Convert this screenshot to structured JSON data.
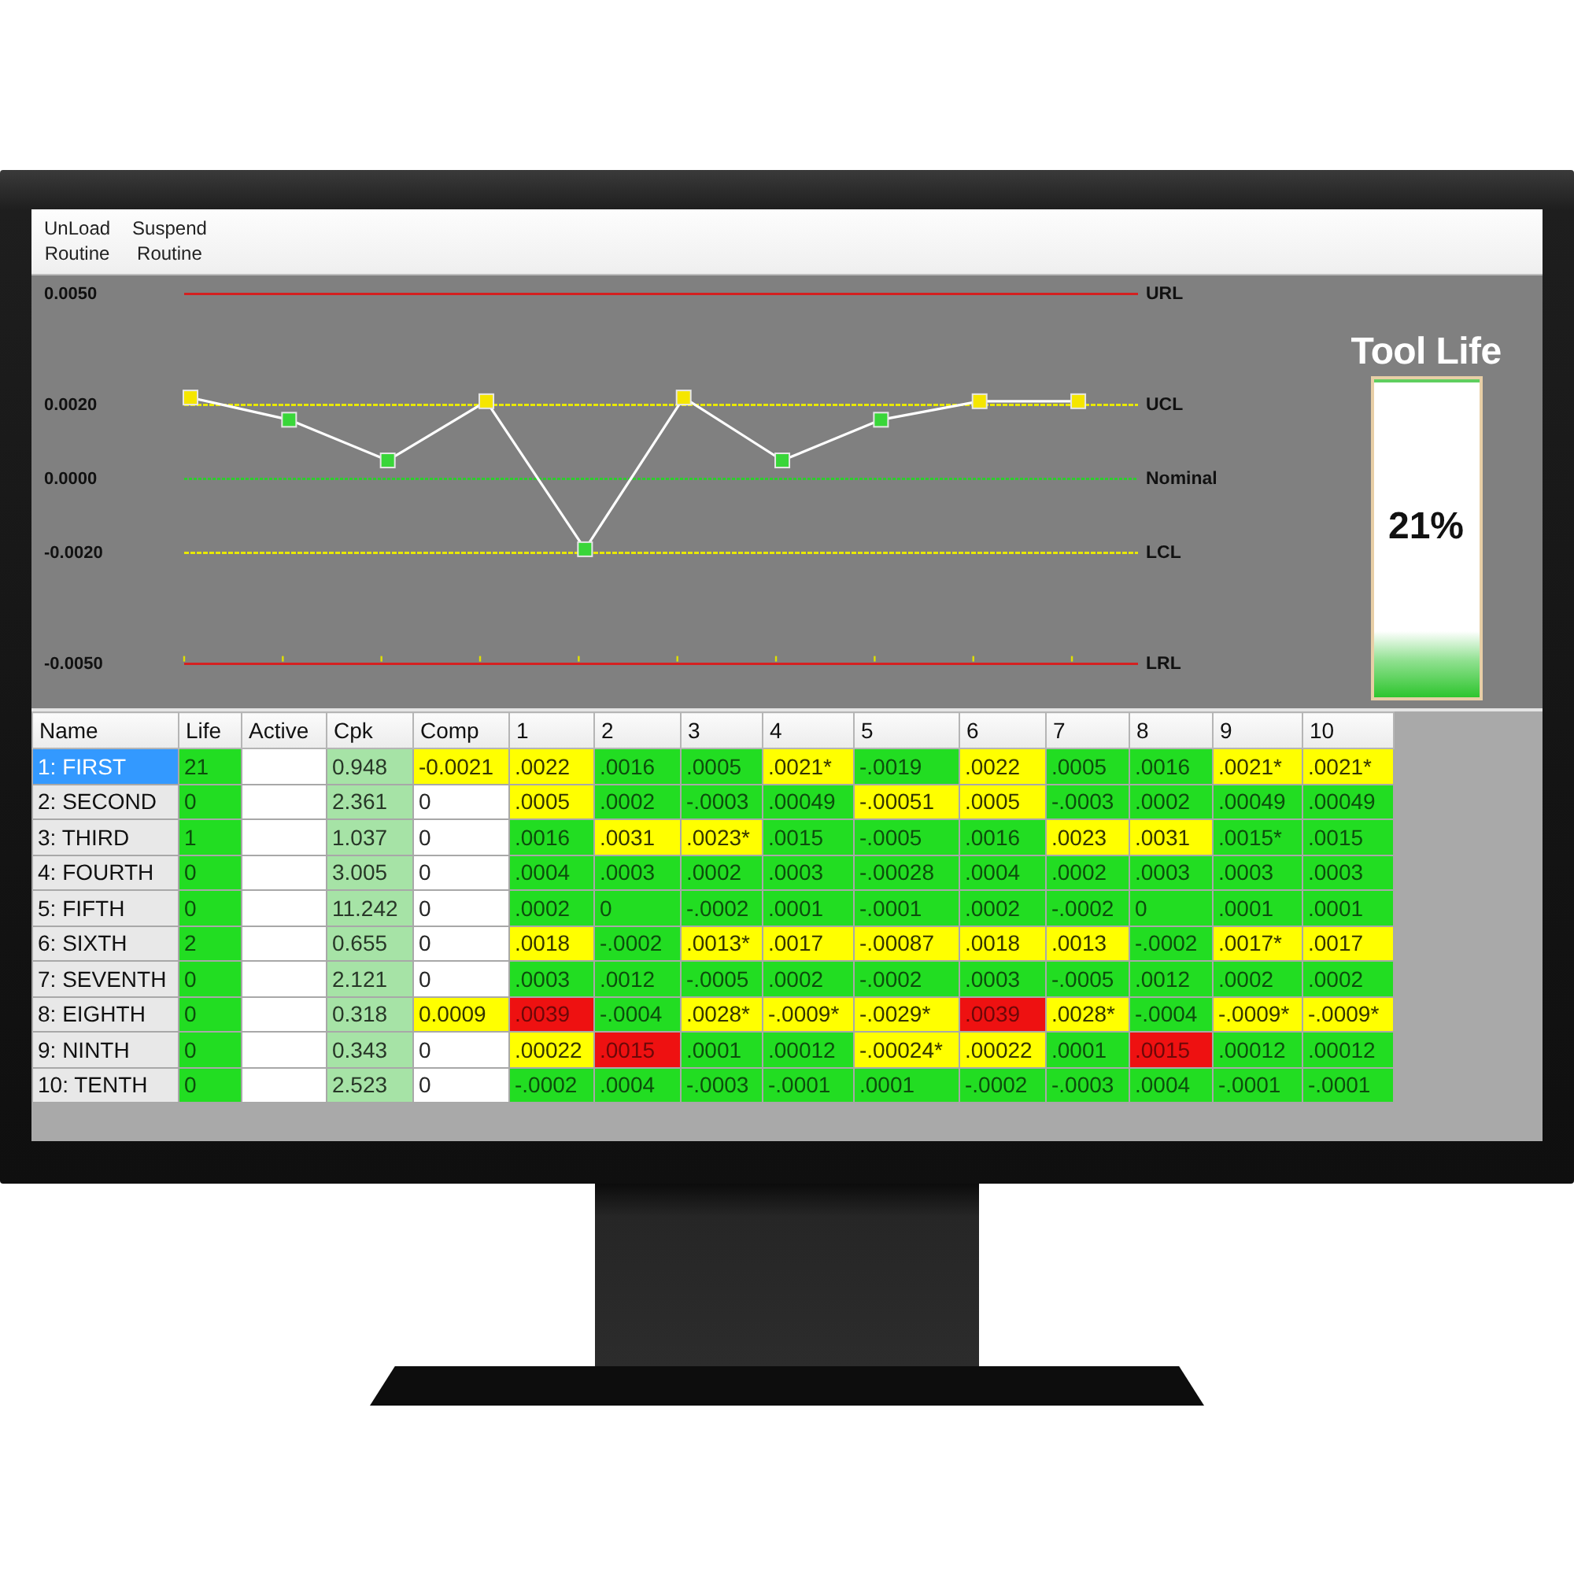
{
  "toolbar": {
    "buttons": [
      "UnLoad Routine",
      "Suspend Routine"
    ]
  },
  "chart": {
    "chart_data": {
      "type": "line",
      "ylim": [
        -0.005,
        0.005
      ],
      "yticks": [
        {
          "value": 0.005,
          "label": "0.0050"
        },
        {
          "value": 0.002,
          "label": "0.0020"
        },
        {
          "value": 0,
          "label": "0.0000"
        },
        {
          "value": -0.002,
          "label": "-0.0020"
        },
        {
          "value": -0.005,
          "label": "-0.0050"
        }
      ],
      "series": [
        {
          "color": "#ffffff",
          "marker": "square",
          "values": [
            0.0022,
            0.0016,
            0.0005,
            0.0021,
            -0.0019,
            0.0022,
            0.0005,
            0.0016,
            0.0021,
            0.0021
          ]
        }
      ],
      "ref_lines": [
        {
          "axis": "y",
          "value": 0.005,
          "label": "URL",
          "color": "#d42020"
        },
        {
          "axis": "y",
          "value": 0.002,
          "label": "UCL",
          "color": "#e8e800"
        },
        {
          "axis": "y",
          "value": 0,
          "label": "Nominal",
          "color": "#2ecc2e"
        },
        {
          "axis": "y",
          "value": -0.002,
          "label": "LCL",
          "color": "#e8e800"
        },
        {
          "axis": "y",
          "value": -0.005,
          "label": "LRL",
          "color": "#d42020"
        }
      ]
    }
  },
  "tool_life": {
    "title": "Tool Life",
    "level": 0.21,
    "reading": "21%"
  },
  "table": {
    "columns": [
      "Name",
      "Life",
      "Active",
      "Cpk",
      "Comp",
      "1",
      "2",
      "3",
      "4",
      "5",
      "6",
      "7",
      "8",
      "9",
      "10"
    ],
    "rows": [
      {
        "name": "1: FIRST",
        "selected": true,
        "life": "21",
        "cpk": "0.948",
        "comp": {
          "text": "-0.0021",
          "color": "#ffff00"
        },
        "readings": [
          {
            "text": ".0022",
            "color": "#ffff00"
          },
          {
            "text": ".0016",
            "color": "#22dd22"
          },
          {
            "text": ".0005",
            "color": "#22dd22"
          },
          {
            "text": ".0021*",
            "color": "#ffff00"
          },
          {
            "text": "-.0019",
            "color": "#22dd22"
          },
          {
            "text": ".0022",
            "color": "#ffff00"
          },
          {
            "text": ".0005",
            "color": "#22dd22"
          },
          {
            "text": ".0016",
            "color": "#22dd22"
          },
          {
            "text": ".0021*",
            "color": "#ffff00"
          },
          {
            "text": ".0021*",
            "color": "#ffff00"
          }
        ]
      },
      {
        "name": "2: SECOND",
        "selected": false,
        "life": "0",
        "cpk": "2.361",
        "comp": {
          "text": "0",
          "color": "#ffffff"
        },
        "readings": [
          {
            "text": ".0005",
            "color": "#ffff00"
          },
          {
            "text": ".0002",
            "color": "#22dd22"
          },
          {
            "text": "-.0003",
            "color": "#22dd22"
          },
          {
            "text": ".00049",
            "color": "#22dd22"
          },
          {
            "text": "-.00051",
            "color": "#ffff00"
          },
          {
            "text": ".0005",
            "color": "#ffff00"
          },
          {
            "text": "-.0003",
            "color": "#22dd22"
          },
          {
            "text": ".0002",
            "color": "#22dd22"
          },
          {
            "text": ".00049",
            "color": "#22dd22"
          },
          {
            "text": ".00049",
            "color": "#22dd22"
          }
        ]
      },
      {
        "name": "3: THIRD",
        "selected": false,
        "life": "1",
        "cpk": "1.037",
        "comp": {
          "text": "0",
          "color": "#ffffff"
        },
        "readings": [
          {
            "text": ".0016",
            "color": "#22dd22"
          },
          {
            "text": ".0031",
            "color": "#ffff00"
          },
          {
            "text": ".0023*",
            "color": "#ffff00"
          },
          {
            "text": ".0015",
            "color": "#22dd22"
          },
          {
            "text": "-.0005",
            "color": "#22dd22"
          },
          {
            "text": ".0016",
            "color": "#22dd22"
          },
          {
            "text": ".0023",
            "color": "#ffff00"
          },
          {
            "text": ".0031",
            "color": "#ffff00"
          },
          {
            "text": ".0015*",
            "color": "#22dd22"
          },
          {
            "text": ".0015",
            "color": "#22dd22"
          }
        ]
      },
      {
        "name": "4: FOURTH",
        "selected": false,
        "life": "0",
        "cpk": "3.005",
        "comp": {
          "text": "0",
          "color": "#ffffff"
        },
        "readings": [
          {
            "text": ".0004",
            "color": "#22dd22"
          },
          {
            "text": ".0003",
            "color": "#22dd22"
          },
          {
            "text": ".0002",
            "color": "#22dd22"
          },
          {
            "text": ".0003",
            "color": "#22dd22"
          },
          {
            "text": "-.00028",
            "color": "#22dd22"
          },
          {
            "text": ".0004",
            "color": "#22dd22"
          },
          {
            "text": ".0002",
            "color": "#22dd22"
          },
          {
            "text": ".0003",
            "color": "#22dd22"
          },
          {
            "text": ".0003",
            "color": "#22dd22"
          },
          {
            "text": ".0003",
            "color": "#22dd22"
          }
        ]
      },
      {
        "name": "5: FIFTH",
        "selected": false,
        "life": "0",
        "cpk": "11.242",
        "comp": {
          "text": "0",
          "color": "#ffffff"
        },
        "readings": [
          {
            "text": ".0002",
            "color": "#22dd22"
          },
          {
            "text": "0",
            "color": "#22dd22"
          },
          {
            "text": "-.0002",
            "color": "#22dd22"
          },
          {
            "text": ".0001",
            "color": "#22dd22"
          },
          {
            "text": "-.0001",
            "color": "#22dd22"
          },
          {
            "text": ".0002",
            "color": "#22dd22"
          },
          {
            "text": "-.0002",
            "color": "#22dd22"
          },
          {
            "text": "0",
            "color": "#22dd22"
          },
          {
            "text": ".0001",
            "color": "#22dd22"
          },
          {
            "text": ".0001",
            "color": "#22dd22"
          }
        ]
      },
      {
        "name": "6: SIXTH",
        "selected": false,
        "life": "2",
        "cpk": "0.655",
        "comp": {
          "text": "0",
          "color": "#ffffff"
        },
        "readings": [
          {
            "text": ".0018",
            "color": "#ffff00"
          },
          {
            "text": "-.0002",
            "color": "#22dd22"
          },
          {
            "text": ".0013*",
            "color": "#ffff00"
          },
          {
            "text": ".0017",
            "color": "#ffff00"
          },
          {
            "text": "-.00087",
            "color": "#ffff00"
          },
          {
            "text": ".0018",
            "color": "#ffff00"
          },
          {
            "text": ".0013",
            "color": "#ffff00"
          },
          {
            "text": "-.0002",
            "color": "#22dd22"
          },
          {
            "text": ".0017*",
            "color": "#ffff00"
          },
          {
            "text": ".0017",
            "color": "#ffff00"
          }
        ]
      },
      {
        "name": "7: SEVENTH",
        "selected": false,
        "life": "0",
        "cpk": "2.121",
        "comp": {
          "text": "0",
          "color": "#ffffff"
        },
        "readings": [
          {
            "text": ".0003",
            "color": "#22dd22"
          },
          {
            "text": ".0012",
            "color": "#22dd22"
          },
          {
            "text": "-.0005",
            "color": "#22dd22"
          },
          {
            "text": ".0002",
            "color": "#22dd22"
          },
          {
            "text": "-.0002",
            "color": "#22dd22"
          },
          {
            "text": ".0003",
            "color": "#22dd22"
          },
          {
            "text": "-.0005",
            "color": "#22dd22"
          },
          {
            "text": ".0012",
            "color": "#22dd22"
          },
          {
            "text": ".0002",
            "color": "#22dd22"
          },
          {
            "text": ".0002",
            "color": "#22dd22"
          }
        ]
      },
      {
        "name": "8: EIGHTH",
        "selected": false,
        "life": "0",
        "cpk": "0.318",
        "comp": {
          "text": "0.0009",
          "color": "#ffff00"
        },
        "readings": [
          {
            "text": ".0039",
            "color": "#ee1111"
          },
          {
            "text": "-.0004",
            "color": "#22dd22"
          },
          {
            "text": ".0028*",
            "color": "#ffff00"
          },
          {
            "text": "-.0009*",
            "color": "#ffff00"
          },
          {
            "text": "-.0029*",
            "color": "#ffff00"
          },
          {
            "text": ".0039",
            "color": "#ee1111"
          },
          {
            "text": ".0028*",
            "color": "#ffff00"
          },
          {
            "text": "-.0004",
            "color": "#22dd22"
          },
          {
            "text": "-.0009*",
            "color": "#ffff00"
          },
          {
            "text": "-.0009*",
            "color": "#ffff00"
          }
        ]
      },
      {
        "name": "9: NINTH",
        "selected": false,
        "life": "0",
        "cpk": "0.343",
        "comp": {
          "text": "0",
          "color": "#ffffff"
        },
        "readings": [
          {
            "text": ".00022",
            "color": "#ffff00"
          },
          {
            "text": ".0015",
            "color": "#ee1111"
          },
          {
            "text": ".0001",
            "color": "#22dd22"
          },
          {
            "text": ".00012",
            "color": "#22dd22"
          },
          {
            "text": "-.00024*",
            "color": "#ffff00"
          },
          {
            "text": ".00022",
            "color": "#ffff00"
          },
          {
            "text": ".0001",
            "color": "#22dd22"
          },
          {
            "text": ".0015",
            "color": "#ee1111"
          },
          {
            "text": ".00012",
            "color": "#22dd22"
          },
          {
            "text": ".00012",
            "color": "#22dd22"
          }
        ]
      },
      {
        "name": "10: TENTH",
        "selected": false,
        "life": "0",
        "cpk": "2.523",
        "comp": {
          "text": "0",
          "color": "#ffffff"
        },
        "readings": [
          {
            "text": "-.0002",
            "color": "#22dd22"
          },
          {
            "text": ".0004",
            "color": "#22dd22"
          },
          {
            "text": "-.0003",
            "color": "#22dd22"
          },
          {
            "text": "-.0001",
            "color": "#22dd22"
          },
          {
            "text": ".0001",
            "color": "#22dd22"
          },
          {
            "text": "-.0002",
            "color": "#22dd22"
          },
          {
            "text": "-.0003",
            "color": "#22dd22"
          },
          {
            "text": ".0004",
            "color": "#22dd22"
          },
          {
            "text": "-.0001",
            "color": "#22dd22"
          },
          {
            "text": "-.0001",
            "color": "#22dd22"
          }
        ]
      }
    ]
  }
}
